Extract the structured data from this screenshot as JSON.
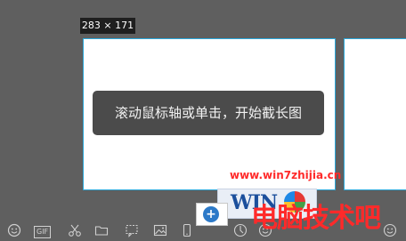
{
  "screenshot": {
    "size_label": "283 × 171",
    "hint_text": "滚动鼠标轴或单击，开始截长图"
  },
  "watermark": {
    "url": "www.win7zhijia.cn",
    "logo_text": "WIN",
    "site_name_cn": "电脑技术吧"
  },
  "toolbar": {
    "gif_label": "GIF",
    "long_capture_symbol": "+",
    "icons": [
      "emoji-icon",
      "gif-icon",
      "scissors-icon",
      "folder-icon",
      "selection-icon",
      "image-icon",
      "mobile-icon",
      "long-capture-icon",
      "palette-icon",
      "smiley-icon",
      "more-icon"
    ]
  },
  "colors": {
    "background": "#5f5f5f",
    "selection_border": "#2aa7d9",
    "toast_bg": "#4b4b4b",
    "watermark_red": "#ff2a2a"
  }
}
